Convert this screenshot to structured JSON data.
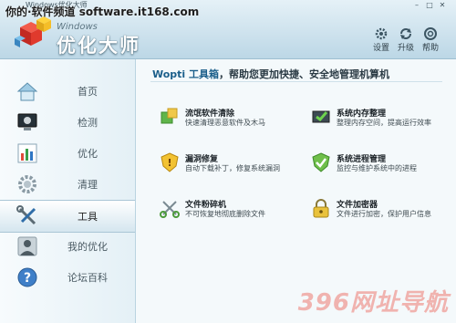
{
  "overlay_caption": "你的·软件频道 software.it168.com",
  "window": {
    "title": "Windows优化大师"
  },
  "brand": {
    "en": "Windows",
    "cn": "优化大师"
  },
  "toolbar": {
    "settings": "设置",
    "upgrade": "升级",
    "help": "帮助"
  },
  "sidebar": {
    "items": [
      {
        "label": "首页"
      },
      {
        "label": "检测"
      },
      {
        "label": "优化"
      },
      {
        "label": "清理"
      },
      {
        "label": "工具"
      },
      {
        "label": "我的优化"
      },
      {
        "label": "论坛百科"
      }
    ]
  },
  "main": {
    "title_prefix": "Wopti 工具箱",
    "title_rest": "，帮助您更加快捷、安全地管理机算机",
    "tools": [
      {
        "name": "流氓软件清除",
        "desc": "快速清理恶意软件及木马"
      },
      {
        "name": "系统内存整理",
        "desc": "整理内存空间，提高运行效率"
      },
      {
        "name": "漏洞修复",
        "desc": "自动下载补丁，修复系统漏洞"
      },
      {
        "name": "系统进程管理",
        "desc": "监控与维护系统中的进程"
      },
      {
        "name": "文件粉碎机",
        "desc": "不可恢复地彻底删除文件"
      },
      {
        "name": "文件加密器",
        "desc": "文件进行加密，保护用户信息"
      }
    ]
  },
  "watermark_bottom": "396网址导航",
  "colors": {
    "accent": "#1a5e8a",
    "header": "#bcd7e6",
    "watermark": "#f0a7a2"
  }
}
